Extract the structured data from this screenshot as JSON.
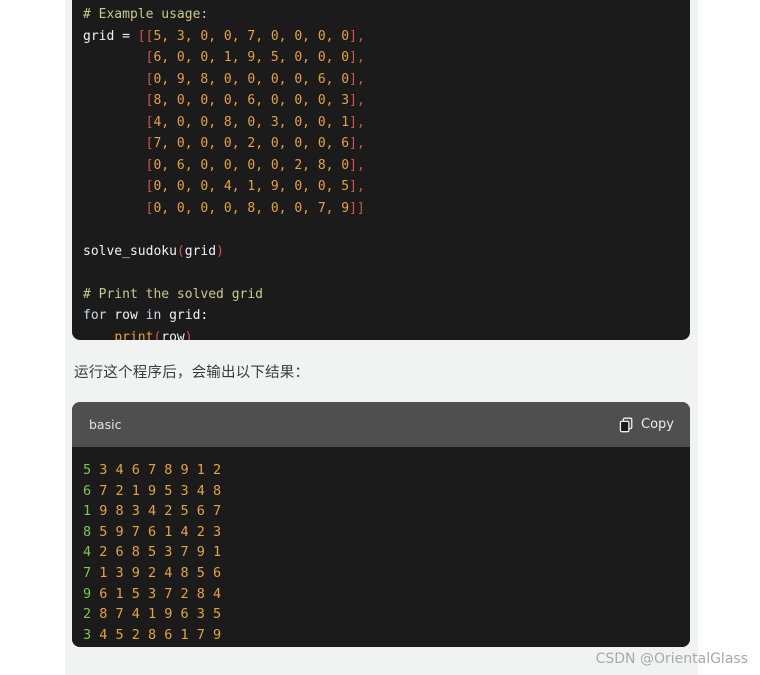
{
  "code_block_top": {
    "lines": [
      {
        "segments": [
          {
            "t": "# Example usage:",
            "c": "tok-comment"
          }
        ]
      },
      {
        "segments": [
          {
            "t": "grid",
            "c": "tok-name"
          },
          {
            "t": " = ",
            "c": "tok-op"
          },
          {
            "t": "[[",
            "c": "tok-brk"
          },
          {
            "t": "5, 3, 0, 0, 7, 0, 0, 0, 0",
            "c": "tok-num"
          },
          {
            "t": "],",
            "c": "tok-brk"
          }
        ]
      },
      {
        "segments": [
          {
            "t": "        [",
            "c": "tok-brk"
          },
          {
            "t": "6, 0, 0, 1, 9, 5, 0, 0, 0",
            "c": "tok-num"
          },
          {
            "t": "],",
            "c": "tok-brk"
          }
        ]
      },
      {
        "segments": [
          {
            "t": "        [",
            "c": "tok-brk"
          },
          {
            "t": "0, 9, 8, 0, 0, 0, 0, 6, 0",
            "c": "tok-num"
          },
          {
            "t": "],",
            "c": "tok-brk"
          }
        ]
      },
      {
        "segments": [
          {
            "t": "        [",
            "c": "tok-brk"
          },
          {
            "t": "8, 0, 0, 0, 6, 0, 0, 0, 3",
            "c": "tok-num"
          },
          {
            "t": "],",
            "c": "tok-brk"
          }
        ]
      },
      {
        "segments": [
          {
            "t": "        [",
            "c": "tok-brk"
          },
          {
            "t": "4, 0, 0, 8, 0, 3, 0, 0, 1",
            "c": "tok-num"
          },
          {
            "t": "],",
            "c": "tok-brk"
          }
        ]
      },
      {
        "segments": [
          {
            "t": "        [",
            "c": "tok-brk"
          },
          {
            "t": "7, 0, 0, 0, 2, 0, 0, 0, 6",
            "c": "tok-num"
          },
          {
            "t": "],",
            "c": "tok-brk"
          }
        ]
      },
      {
        "segments": [
          {
            "t": "        [",
            "c": "tok-brk"
          },
          {
            "t": "0, 6, 0, 0, 0, 0, 2, 8, 0",
            "c": "tok-num"
          },
          {
            "t": "],",
            "c": "tok-brk"
          }
        ]
      },
      {
        "segments": [
          {
            "t": "        [",
            "c": "tok-brk"
          },
          {
            "t": "0, 0, 0, 4, 1, 9, 0, 0, 5",
            "c": "tok-num"
          },
          {
            "t": "],",
            "c": "tok-brk"
          }
        ]
      },
      {
        "segments": [
          {
            "t": "        [",
            "c": "tok-brk"
          },
          {
            "t": "0, 0, 0, 0, 8, 0, 0, 7, 9",
            "c": "tok-num"
          },
          {
            "t": "]]",
            "c": "tok-brk"
          }
        ]
      },
      {
        "segments": []
      },
      {
        "segments": [
          {
            "t": "solve_sudoku",
            "c": "tok-name"
          },
          {
            "t": "(",
            "c": "tok-brk"
          },
          {
            "t": "grid",
            "c": "tok-name"
          },
          {
            "t": ")",
            "c": "tok-brk"
          }
        ]
      },
      {
        "segments": []
      },
      {
        "segments": [
          {
            "t": "# Print the solved grid",
            "c": "tok-comment"
          }
        ]
      },
      {
        "segments": [
          {
            "t": "for",
            "c": "tok-kw"
          },
          {
            "t": " row ",
            "c": "tok-name"
          },
          {
            "t": "in",
            "c": "tok-kw"
          },
          {
            "t": " grid",
            "c": "tok-name"
          },
          {
            "t": ":",
            "c": "tok-op"
          }
        ]
      },
      {
        "segments": [
          {
            "t": "    ",
            "c": "tok-name"
          },
          {
            "t": "print",
            "c": "tok-fn"
          },
          {
            "t": "(",
            "c": "tok-brk"
          },
          {
            "t": "row",
            "c": "tok-name"
          },
          {
            "t": ")",
            "c": "tok-brk"
          }
        ]
      }
    ]
  },
  "paragraph": "运行这个程序后，会输出以下结果：",
  "output_block": {
    "language_label": "basic",
    "copy_label": "Copy",
    "copy_icon": "copy-icon",
    "rows": [
      {
        "first": "5",
        "rest": "3 4 6 7 8 9 1 2"
      },
      {
        "first": "6",
        "rest": "7 2 1 9 5 3 4 8"
      },
      {
        "first": "1",
        "rest": "9 8 3 4 2 5 6 7"
      },
      {
        "first": "8",
        "rest": "5 9 7 6 1 4 2 3"
      },
      {
        "first": "4",
        "rest": "2 6 8 5 3 7 9 1"
      },
      {
        "first": "7",
        "rest": "1 3 9 2 4 8 5 6"
      },
      {
        "first": "9",
        "rest": "6 1 5 3 7 2 8 4"
      },
      {
        "first": "2",
        "rest": "8 7 4 1 9 6 3 5"
      },
      {
        "first": "3",
        "rest": "4 5 2 8 6 1 7 9"
      }
    ]
  },
  "watermark": "CSDN @OrientalGlass",
  "colors": {
    "page_background": "#ffffff",
    "column_background": "#f1f2f2",
    "code_background": "#1b1b1b",
    "header_background": "#504f4f",
    "number_token": "#e8a33d",
    "bracket_token": "#d4544c",
    "comment_token": "#c9c98a",
    "output_first_digit": "#7ec84a",
    "watermark_color": "#a9a9a9"
  }
}
